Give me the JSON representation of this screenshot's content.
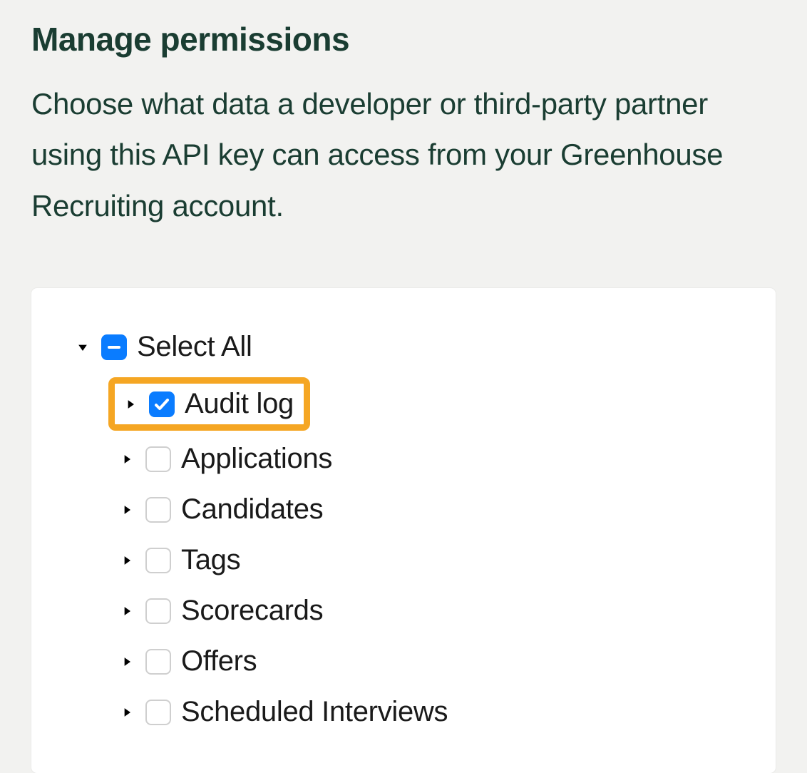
{
  "header": {
    "title": "Manage permissions",
    "description": "Choose what data a developer or third-party partner using this API key can access from your Greenhouse Recruiting account."
  },
  "tree": {
    "root": {
      "label": "Select All",
      "state": "indeterminate",
      "expanded": true
    },
    "items": [
      {
        "label": "Audit log",
        "state": "checked",
        "expanded": false,
        "highlighted": true
      },
      {
        "label": "Applications",
        "state": "unchecked",
        "expanded": false,
        "highlighted": false
      },
      {
        "label": "Candidates",
        "state": "unchecked",
        "expanded": false,
        "highlighted": false
      },
      {
        "label": "Tags",
        "state": "unchecked",
        "expanded": false,
        "highlighted": false
      },
      {
        "label": "Scorecards",
        "state": "unchecked",
        "expanded": false,
        "highlighted": false
      },
      {
        "label": "Offers",
        "state": "unchecked",
        "expanded": false,
        "highlighted": false
      },
      {
        "label": "Scheduled Interviews",
        "state": "unchecked",
        "expanded": false,
        "highlighted": false
      }
    ]
  }
}
